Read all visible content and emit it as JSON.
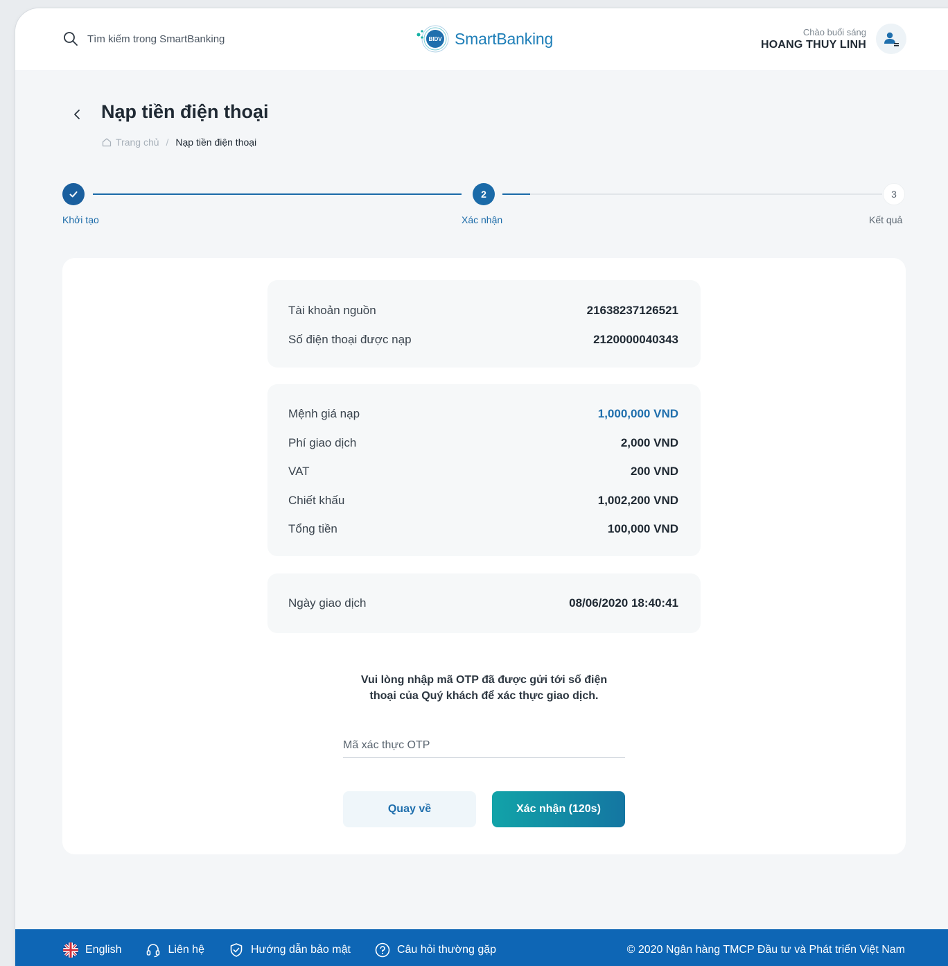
{
  "header": {
    "search_placeholder": "Tìm kiếm trong SmartBanking",
    "logo_badge": "BIDV",
    "logo_text": "SmartBanking",
    "greeting": "Chào buổi sáng",
    "username": "HOANG THUY LINH"
  },
  "page": {
    "title": "Nạp tiền điện thoại",
    "breadcrumb_home": "Trang chủ",
    "breadcrumb_current": "Nạp tiền điện thoại"
  },
  "stepper": {
    "steps": [
      {
        "number": "1",
        "label": "Khởi tạo",
        "state": "done"
      },
      {
        "number": "2",
        "label": "Xác nhận",
        "state": "active"
      },
      {
        "number": "3",
        "label": "Kết quả",
        "state": "pending"
      }
    ]
  },
  "details": {
    "source_account_label": "Tài khoản nguồn",
    "source_account_value": "21638237126521",
    "phone_label": "Số điện thoại được nạp",
    "phone_value": "2120000040343",
    "denomination_label": "Mệnh giá nạp",
    "denomination_value": "1,000,000 VND",
    "fee_label": "Phí giao dịch",
    "fee_value": "2,000 VND",
    "vat_label": "VAT",
    "vat_value": "200 VND",
    "discount_label": "Chiết khấu",
    "discount_value": "1,002,200 VND",
    "total_label": "Tổng tiền",
    "total_value": "100,000 VND",
    "date_label": "Ngày giao dịch",
    "date_value": "08/06/2020 18:40:41"
  },
  "otp": {
    "message_line1": "Vui lòng nhập mã OTP đã được gửi tới số điện",
    "message_line2": "thoại của Quý khách để xác thực giao dịch.",
    "placeholder": "Mã xác thực OTP",
    "value": ""
  },
  "buttons": {
    "back": "Quay về",
    "confirm": "Xác nhận (120s)"
  },
  "footer": {
    "language": "English",
    "contact": "Liên hệ",
    "security_guide": "Hướng dẫn bảo mật",
    "faq": "Câu hỏi thường gặp",
    "copyright": "© 2020 Ngân hàng TMCP Đầu tư và Phát triển Việt Nam"
  },
  "colors": {
    "primary": "#1f6fad",
    "footer": "#0e66b5",
    "step_active": "#1a6aa8",
    "confirm_gradient_start": "#12a3a8",
    "confirm_gradient_end": "#1476a2"
  }
}
